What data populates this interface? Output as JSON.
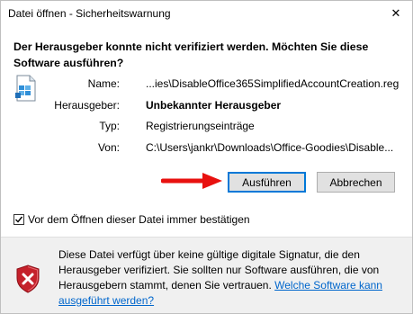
{
  "window": {
    "title": "Datei öffnen - Sicherheitswarnung",
    "close_symbol": "✕"
  },
  "dialog": {
    "heading": "Der Herausgeber konnte nicht verifiziert werden. Möchten Sie diese Software ausführen?",
    "file_icon": "registry-file-icon",
    "fields": {
      "name_label": "Name:",
      "name_value": "...ies\\DisableOffice365SimplifiedAccountCreation.reg",
      "publisher_label": "Herausgeber:",
      "publisher_value": "Unbekannter Herausgeber",
      "type_label": "Typ:",
      "type_value": "Registrierungseinträge",
      "from_label": "Von:",
      "from_value": "C:\\Users\\jankr\\Downloads\\Office-Goodies\\Disable..."
    },
    "buttons": {
      "run": "Ausführen",
      "cancel": "Abbrechen"
    },
    "checkbox": {
      "label": "Vor dem Öffnen dieser Datei immer bestätigen",
      "checked": true
    }
  },
  "warning": {
    "icon": "shield-error-icon",
    "text": "Diese Datei verfügt über keine gültige digitale Signatur, die den Herausgeber verifiziert. Sie sollten nur Software ausführen, die von Herausgebern stammt, denen Sie vertrauen. ",
    "link": "Welche Software kann ausgeführt werden?"
  },
  "colors": {
    "accent": "#0078d7",
    "arrow": "#e8110f",
    "link": "#0066cc",
    "shield": "#c5212b"
  }
}
